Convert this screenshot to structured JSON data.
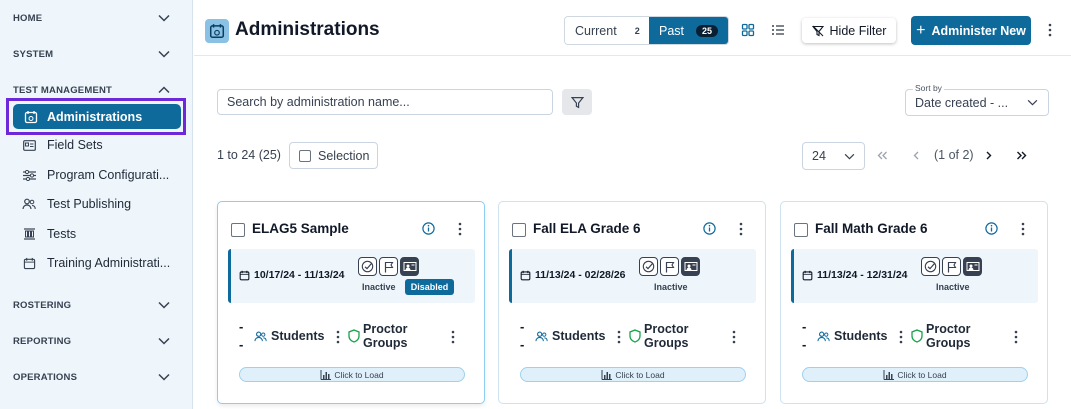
{
  "sidebar": {
    "sections": {
      "home": "HOME",
      "system": "SYSTEM",
      "test_management": "TEST MANAGEMENT",
      "rostering": "ROSTERING",
      "reporting": "REPORTING",
      "operations": "OPERATIONS"
    },
    "items": [
      {
        "label": "Administrations",
        "icon": "calendar-icon",
        "active": true
      },
      {
        "label": "Field Sets",
        "icon": "id-card-icon"
      },
      {
        "label": "Program Configurati...",
        "icon": "sliders-icon"
      },
      {
        "label": "Test Publishing",
        "icon": "users-icon"
      },
      {
        "label": "Tests",
        "icon": "tests-icon"
      },
      {
        "label": "Training Administrati...",
        "icon": "calendar-icon"
      }
    ]
  },
  "header": {
    "title": "Administrations",
    "current_label": "Current",
    "current_count": "2",
    "past_label": "Past",
    "past_count": "25",
    "hide_filter": "Hide Filter",
    "administer_new": "Administer New"
  },
  "toolbar": {
    "search_placeholder": "Search by administration name...",
    "sort_label": "Sort by",
    "sort_value": "Date created - ...",
    "range": "1 to 24 (25)",
    "selection": "Selection",
    "page_size": "24",
    "page_info": "(1 of 2)"
  },
  "cards": [
    {
      "name": "ELAG5 Sample",
      "dates": "10/17/24 - 11/13/24",
      "status": "Inactive",
      "badge": "Disabled",
      "students": "Students",
      "proctor_1": "Proctor",
      "proctor_2": "Groups",
      "load": "Click to Load"
    },
    {
      "name": "Fall ELA Grade 6",
      "dates": "11/13/24 - 02/28/26",
      "status": "Inactive",
      "students": "Students",
      "proctor_1": "Proctor",
      "proctor_2": "Groups",
      "load": "Click to Load"
    },
    {
      "name": "Fall Math Grade 6",
      "dates": "11/13/24 - 12/31/24",
      "status": "Inactive",
      "students": "Students",
      "proctor_1": "Proctor",
      "proctor_2": "Groups",
      "load": "Click to Load"
    }
  ],
  "colors": {
    "primary": "#0f6a9c",
    "sidebar_bg": "#eef6fb",
    "highlight": "#6d28d9"
  }
}
